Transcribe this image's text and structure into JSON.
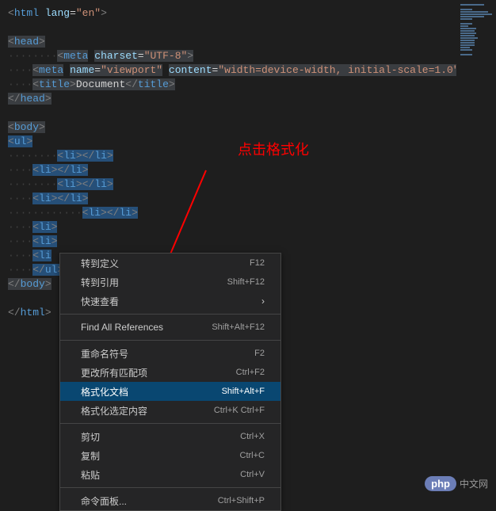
{
  "annotation": {
    "label": "点击格式化"
  },
  "code": {
    "line0": {
      "open": "<",
      "tag": "html",
      "sp": " ",
      "attr": "lang",
      "eq": "=",
      "val": "\"en\"",
      "close": ">"
    },
    "line2": {
      "open": "<",
      "tag": "head",
      "close": ">"
    },
    "line3": {
      "ws": "········",
      "open": "<",
      "tag": "meta",
      "sp": " ",
      "attr": "charset",
      "eq": "=",
      "val": "\"UTF-8\"",
      "close": ">"
    },
    "line4": {
      "ws": "····",
      "open": "<",
      "tag": "meta",
      "sp": " ",
      "attr1": "name",
      "eq": "=",
      "val1": "\"viewport\"",
      "sp2": " ",
      "attr2": "content",
      "val2": "\"width=device-width, initial-scale=1.0\"",
      "close": ">"
    },
    "line5": {
      "ws": "····",
      "open": "<",
      "tag": "title",
      "close": ">",
      "text": "Document",
      "open2": "</",
      "close2": ">"
    },
    "line6": {
      "open": "</",
      "tag": "head",
      "close": ">"
    },
    "line8": {
      "open": "<",
      "tag": "body",
      "close": ">"
    },
    "line9": {
      "open": "<",
      "tag": "ul",
      "close": ">"
    },
    "line10": {
      "ws": "········",
      "open": "<",
      "tag": "li",
      "close": ">",
      "open2": "</",
      "close2": ">"
    },
    "line11": {
      "ws": "····",
      "open": "<",
      "tag": "li",
      "close": ">",
      "open2": "</",
      "close2": ">"
    },
    "line12": {
      "ws": "········",
      "open": "<",
      "tag": "li",
      "close": ">",
      "open2": "</",
      "close2": ">"
    },
    "line13": {
      "ws": "····",
      "open": "<",
      "tag": "li",
      "close": ">",
      "open2": "</",
      "close2": ">"
    },
    "line14": {
      "ws": "············",
      "open": "<",
      "tag": "li",
      "close": ">",
      "open2": "</",
      "close2": ">"
    },
    "line15": {
      "ws": "····",
      "open": "<",
      "tag": "li",
      "close": ">",
      "open2": "</",
      "close2": ">"
    },
    "line16": {
      "ws": "····",
      "open": "<",
      "tag": "li",
      "close": ">",
      "open2": "</",
      "close2": ">"
    },
    "line17": {
      "ws": "····",
      "open": "<",
      "tag": "li",
      "close": ">",
      "open2": "</",
      "close2": ">"
    },
    "line18": {
      "ws": "····",
      "open": "</",
      "tag": "ul",
      "close": ">"
    },
    "line19": {
      "open": "</",
      "tag": "body",
      "close": ">"
    },
    "line21": {
      "open": "</",
      "tag": "html",
      "close": ">"
    }
  },
  "menu": {
    "items": [
      {
        "label": "转到定义",
        "shortcut": "F12"
      },
      {
        "label": "转到引用",
        "shortcut": "Shift+F12"
      },
      {
        "label": "快速查看",
        "shortcut": "",
        "submenu": true
      }
    ],
    "items2": [
      {
        "label": "Find All References",
        "shortcut": "Shift+Alt+F12"
      }
    ],
    "items3": [
      {
        "label": "重命名符号",
        "shortcut": "F2"
      },
      {
        "label": "更改所有匹配项",
        "shortcut": "Ctrl+F2"
      },
      {
        "label": "格式化文档",
        "shortcut": "Shift+Alt+F",
        "selected": true
      },
      {
        "label": "格式化选定内容",
        "shortcut": "Ctrl+K Ctrl+F"
      }
    ],
    "items4": [
      {
        "label": "剪切",
        "shortcut": "Ctrl+X"
      },
      {
        "label": "复制",
        "shortcut": "Ctrl+C"
      },
      {
        "label": "粘贴",
        "shortcut": "Ctrl+V"
      }
    ],
    "items5": [
      {
        "label": "命令面板...",
        "shortcut": "Ctrl+Shift+P"
      }
    ]
  },
  "watermark": {
    "php": "php",
    "cn": "中文网"
  }
}
